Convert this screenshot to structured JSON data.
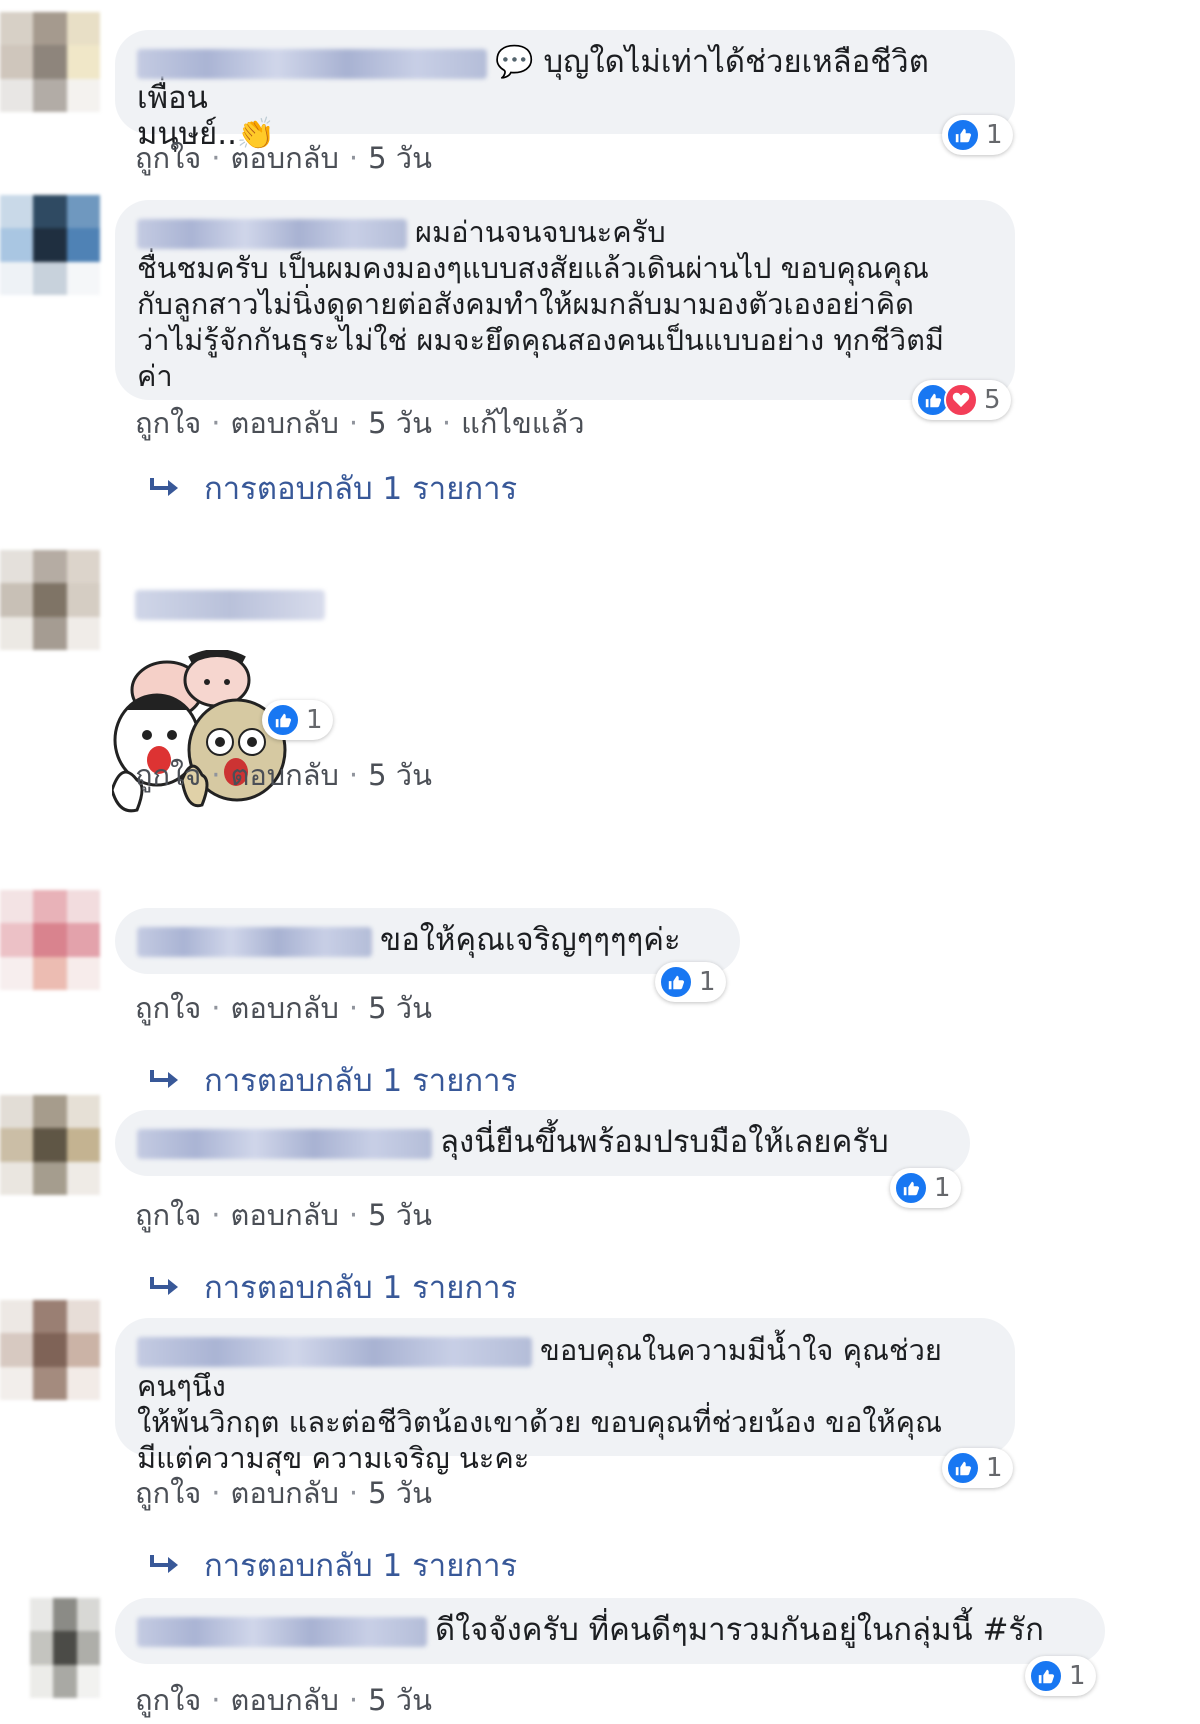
{
  "comments": [
    {
      "text": "💬 บุญใดไม่เท่าได้ช่วยเหลือชีวิตเพื่อน\nมนุษย์..👏",
      "reaction_count": "1",
      "actions": {
        "like": "ถูกใจ",
        "reply": "ตอบกลับ",
        "time": "5 วัน"
      }
    },
    {
      "text": "ผมอ่านจนจบนะครับ\nชื่นชมครับ เป็นผมคงมองๆแบบสงสัยแล้วเดินผ่านไป ขอบคุณคุณ\nกับลูกสาวไม่นิ่งดูดายต่อสังคมทำให้ผมกลับมามองตัวเองอย่าคิด\nว่าไม่รู้จักกันธุระไม่ใช่ ผมจะยึดคุณสองคนเป็นแบบอย่าง ทุกชีวิตมี\nค่า",
      "reaction_count": "5",
      "actions": {
        "like": "ถูกใจ",
        "reply": "ตอบกลับ",
        "time": "5 วัน",
        "edited": "แก้ไขแล้ว"
      },
      "replies_label": "การตอบกลับ 1 รายการ"
    },
    {
      "sticker": "sticker-image",
      "reaction_count": "1",
      "actions": {
        "like": "ถูกใจ",
        "reply": "ตอบกลับ",
        "time": "5 วัน"
      }
    },
    {
      "text": "ขอให้คุณเจริญๆๆๆๆค่ะ",
      "reaction_count": "1",
      "actions": {
        "like": "ถูกใจ",
        "reply": "ตอบกลับ",
        "time": "5 วัน"
      },
      "replies_label": "การตอบกลับ 1 รายการ"
    },
    {
      "text": "ลุงนี่ยืนขึ้นพร้อมปรบมือให้เลยครับ",
      "reaction_count": "1",
      "actions": {
        "like": "ถูกใจ",
        "reply": "ตอบกลับ",
        "time": "5 วัน"
      },
      "replies_label": "การตอบกลับ 1 รายการ"
    },
    {
      "text": "ขอบคุณในความมีน้ำใจ คุณช่วยคนๆนึง\nให้พ้นวิกฤต และต่อชีวิตน้องเขาด้วย ขอบคุณที่ช่วยน้อง ขอให้คุณ\nมีแต่ความสุข ความเจริญ นะคะ",
      "reaction_count": "1",
      "actions": {
        "like": "ถูกใจ",
        "reply": "ตอบกลับ",
        "time": "5 วัน"
      },
      "replies_label": "การตอบกลับ 1 รายการ"
    },
    {
      "text": "ดีใจจังครับ ที่คนดีๆมารวมกันอยู่ในกลุ่มนี้ #รัก",
      "reaction_count": "1",
      "actions": {
        "like": "ถูกใจ",
        "reply": "ตอบกลับ",
        "time": "5 วัน"
      }
    }
  ],
  "colors": {
    "like_blue": "#1877f2",
    "love_red": "#f33e58",
    "link_blue": "#385898",
    "bubble_bg": "#f0f2f5"
  }
}
